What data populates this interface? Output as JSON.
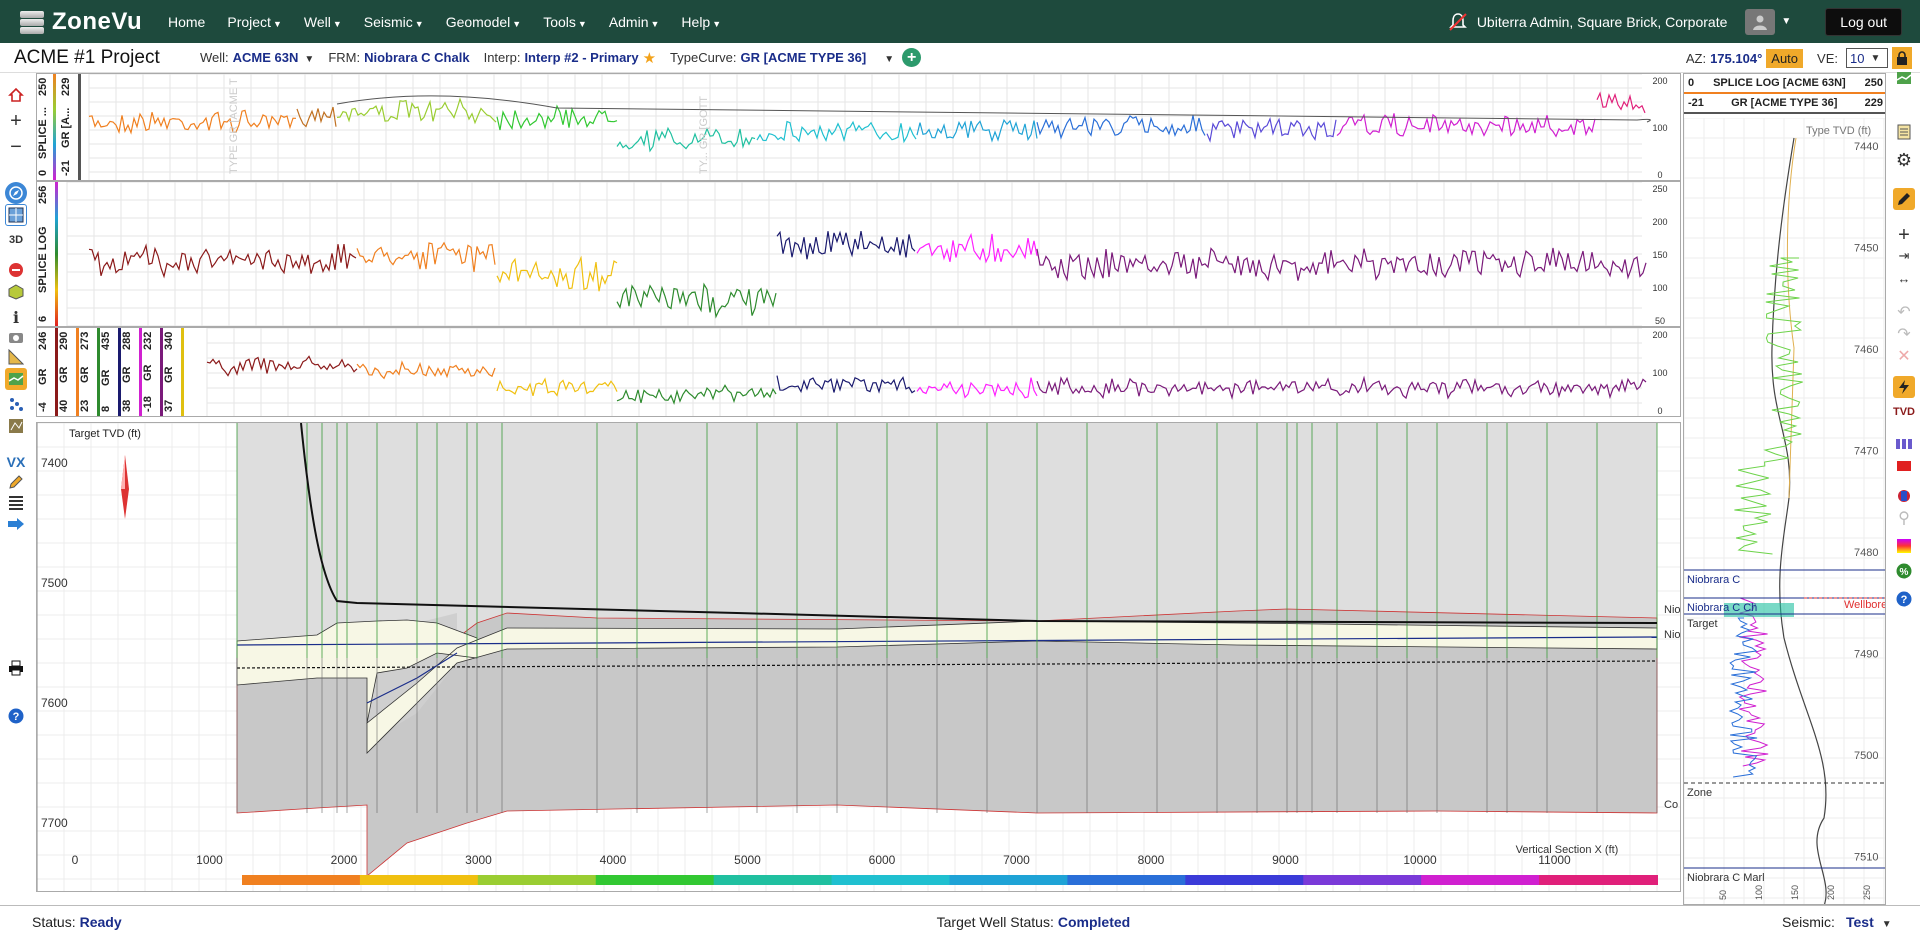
{
  "app": {
    "name": "ZoneVu"
  },
  "nav": {
    "items": [
      {
        "label": "Home",
        "dropdown": false
      },
      {
        "label": "Project",
        "dropdown": true
      },
      {
        "label": "Well",
        "dropdown": true
      },
      {
        "label": "Seismic",
        "dropdown": true
      },
      {
        "label": "Geomodel",
        "dropdown": true
      },
      {
        "label": "Tools",
        "dropdown": true
      },
      {
        "label": "Admin",
        "dropdown": true
      },
      {
        "label": "Help",
        "dropdown": true
      }
    ],
    "user": "Ubiterra Admin, Square Brick, Corporate",
    "logout": "Log out"
  },
  "project": {
    "title": "ACME #1 Project",
    "well_label": "Well:",
    "well_value": "ACME 63N",
    "frm_label": "FRM:",
    "frm_value": "Niobrara C Chalk",
    "interp_label": "Interp:",
    "interp_value": "Interp #2 - Primary",
    "typecurve_label": "TypeCurve:",
    "typecurve_value": "GR [ACME TYPE 36]",
    "az_label": "AZ:",
    "az_value": "175.104°",
    "auto_label": "Auto",
    "ve_label": "VE:",
    "ve_value": "10"
  },
  "tracks": {
    "top": {
      "labels": [
        {
          "name": "SPLICE ...",
          "min": "0",
          "max": "250"
        },
        {
          "name": "GR [A...",
          "min": "-21",
          "max": "229"
        }
      ],
      "scale": [
        "200",
        "100",
        "0"
      ],
      "watermarks": [
        "TYPE GR [ACME T",
        "TY... GR [GOTT"
      ]
    },
    "middle": {
      "labels": [
        {
          "name": "SPLICE LOG",
          "min": "6",
          "max": "256"
        }
      ],
      "scale": [
        "250",
        "200",
        "150",
        "100",
        "50"
      ]
    },
    "bottom": {
      "labels": [
        {
          "name": "GR",
          "min": "-4",
          "max": "246"
        },
        {
          "name": "GR",
          "min": "40",
          "max": "290"
        },
        {
          "name": "GR",
          "min": "23",
          "max": "273"
        },
        {
          "name": "GR",
          "min": "8",
          "max": "435"
        },
        {
          "name": "GR",
          "min": "38",
          "max": "288"
        },
        {
          "name": "GR",
          "min": "-18",
          "max": "232"
        },
        {
          "name": "GR",
          "min": "37",
          "max": "340"
        }
      ],
      "scale": [
        "200",
        "100",
        "0"
      ]
    }
  },
  "section": {
    "y_axis_title": "Target TVD (ft)",
    "y_ticks": [
      "7400",
      "7500",
      "7600",
      "7700"
    ],
    "x_axis_title": "Vertical Section X (ft)",
    "x_ticks": [
      "0",
      "1000",
      "2000",
      "3000",
      "4000",
      "5000",
      "6000",
      "7000",
      "8000",
      "9000",
      "10000",
      "11000"
    ],
    "right_labels": [
      "Nio",
      "Nio",
      "Co"
    ]
  },
  "typelog": {
    "legend": [
      {
        "min": "0",
        "name": "SPLICE LOG [ACME 63N]",
        "max": "250"
      },
      {
        "min": "-21",
        "name": "GR [ACME TYPE 36]",
        "max": "229"
      }
    ],
    "axis_title": "Type TVD (ft)",
    "depth_ticks": [
      "7440",
      "7450",
      "7460",
      "7470",
      "7480",
      "7490",
      "7500",
      "7510"
    ],
    "zones": [
      "Niobrara C",
      "Niobrara C Ch",
      "Target",
      "Zone",
      "Niobrara C Marl"
    ],
    "wellbore_label": "Wellbore",
    "x_ticks": [
      "50",
      "100",
      "150",
      "200",
      "250"
    ]
  },
  "status": {
    "status_label": "Status:",
    "status_value": "Ready",
    "target_label": "Target Well Status:",
    "target_value": "Completed",
    "seismic_label": "Seismic:",
    "seismic_value": "Test"
  },
  "colors": {
    "nav_bg": "#1e4a3d",
    "accent": "#f0a92a",
    "value_blue": "#1a2d8a"
  }
}
